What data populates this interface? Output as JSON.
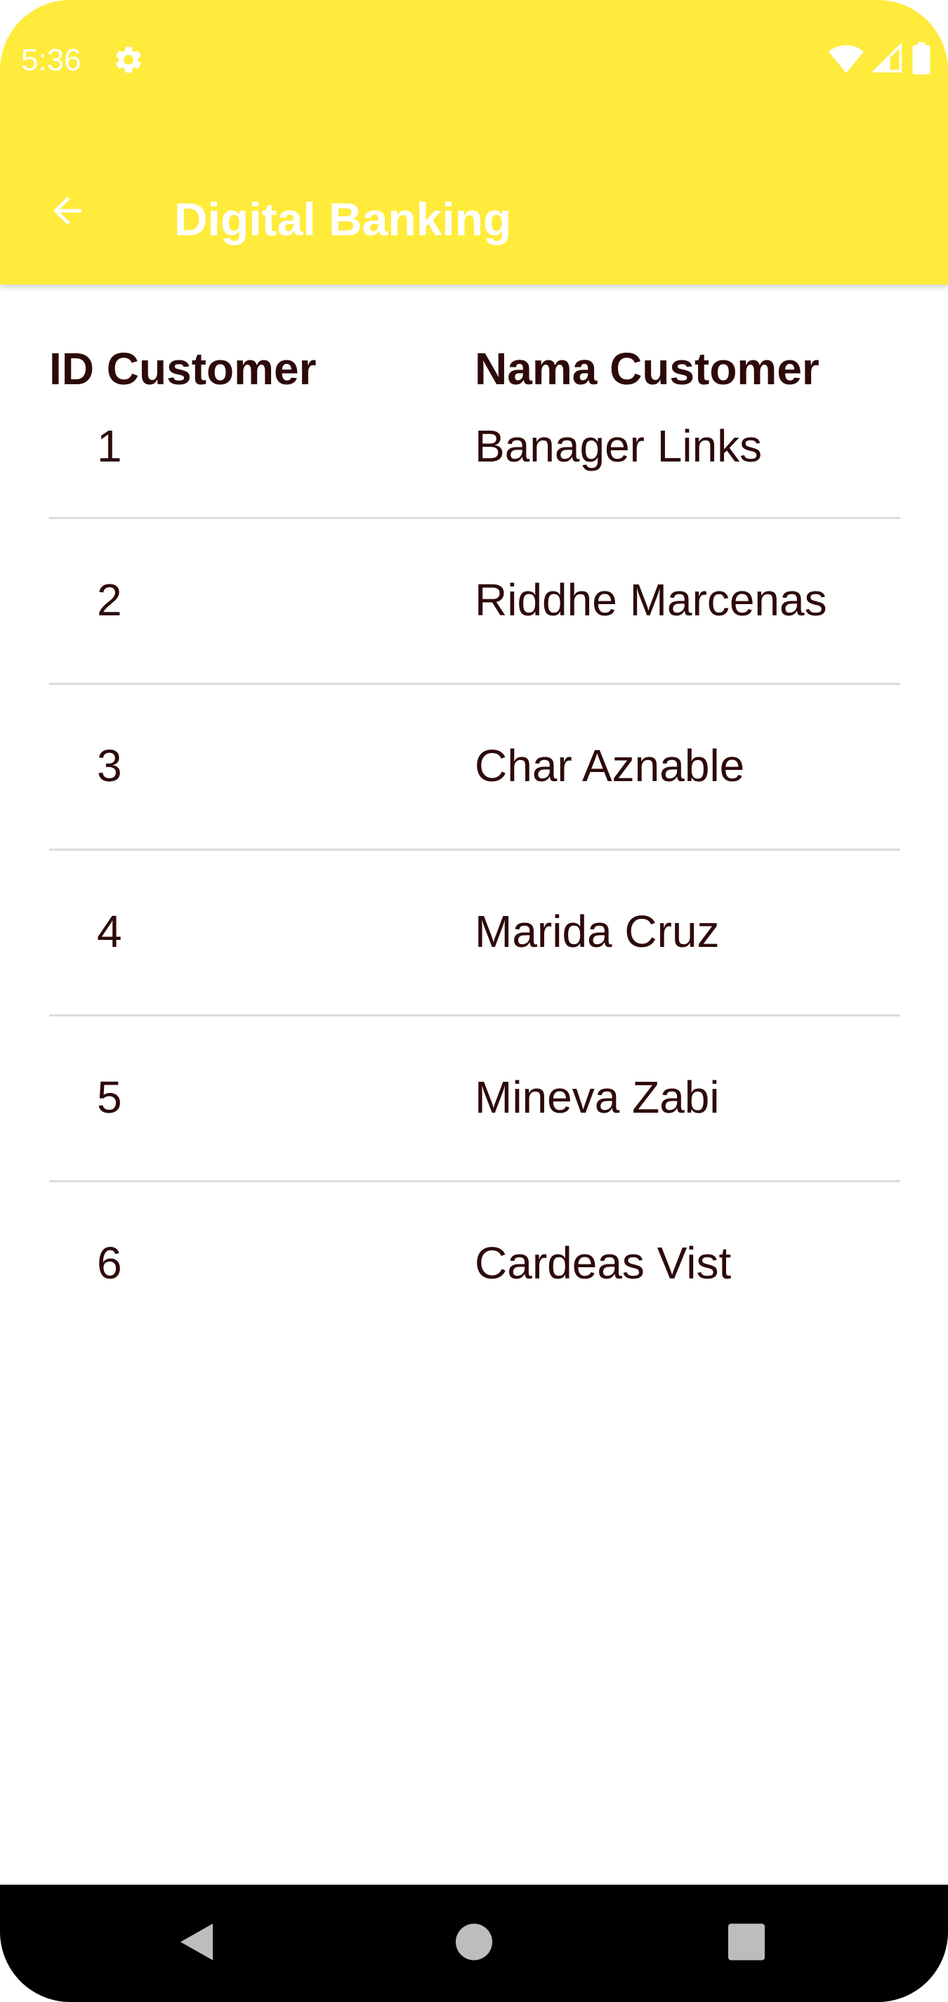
{
  "status_bar": {
    "time": "5:36",
    "icons": [
      "settings-gear-icon",
      "wifi-icon",
      "cellular-signal-icon",
      "battery-icon"
    ]
  },
  "app_bar": {
    "title": "Digital Banking",
    "back_icon": "arrow-back-icon",
    "background_color": "#FFEB3B",
    "title_color": "#FFFFFF"
  },
  "table": {
    "headers": {
      "id": "ID Customer",
      "name": "Nama Customer"
    },
    "rows": [
      {
        "id": "1",
        "name": "Banager Links"
      },
      {
        "id": "2",
        "name": "Riddhe Marcenas"
      },
      {
        "id": "3",
        "name": "Char Aznable"
      },
      {
        "id": "4",
        "name": "Marida Cruz"
      },
      {
        "id": "5",
        "name": "Mineva Zabi"
      },
      {
        "id": "6",
        "name": "Cardeas Vist"
      }
    ]
  },
  "nav_bar": {
    "buttons": [
      "back-triangle-icon",
      "home-circle-icon",
      "recents-square-icon"
    ]
  }
}
